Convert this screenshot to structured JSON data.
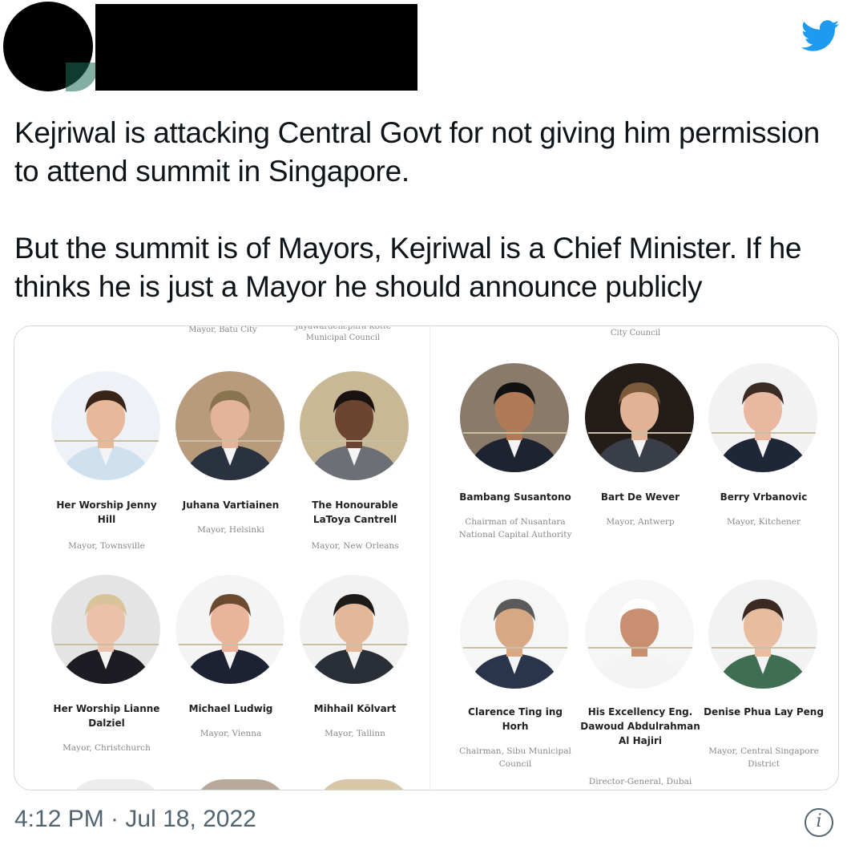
{
  "tweet": {
    "text_line1": "Kejriwal is attacking Central  Govt for not giving him permission to attend summit in Singapore.",
    "text_line2": "But the summit is of Mayors, Kejriwal is a Chief Minister. If he thinks he is just a Mayor he should announce publicly",
    "timestamp": "4:12 PM · Jul 18, 2022",
    "info_glyph": "i"
  },
  "media": {
    "top_captions": [
      "Mayor, Batu City",
      "Jayawardenepura Kotte Municipal Council",
      "City Council"
    ],
    "people": [
      {
        "name": "Her Worship Jenny Hill",
        "role": "Mayor, Townsville",
        "bg": "#eef2f6",
        "skin": "#e7b89a",
        "hair": "#3a2418",
        "suit": "#cfe0ef"
      },
      {
        "name": "Juhana Vartiainen",
        "role": "Mayor, Helsinki",
        "bg": "#b89a7c",
        "skin": "#e4b49a",
        "hair": "#8a7450",
        "suit": "#2a3240"
      },
      {
        "name": "The Honourable LaToya Cantrell",
        "role": "Mayor, New Orleans",
        "bg": "#c8b896",
        "skin": "#6b4532",
        "hair": "#1a1210",
        "suit": "#6d6f76"
      },
      {
        "name": "Bambang Susantono",
        "role": "Chairman of Nusantara National Capital Authority",
        "bg": "#8a7a6a",
        "skin": "#b07a56",
        "hair": "#111111",
        "suit": "#1e2330"
      },
      {
        "name": "Bart De Wever",
        "role": "Mayor, Antwerp",
        "bg": "#241c18",
        "skin": "#e2b294",
        "hair": "#7a5a3a",
        "suit": "#3a3e48"
      },
      {
        "name": "Berry Vrbanovic",
        "role": "Mayor, Kitchener",
        "bg": "#f2f2f2",
        "skin": "#e8b8a0",
        "hair": "#3a2c24",
        "suit": "#1f2638"
      },
      {
        "name": "Her Worship Lianne Dalziel",
        "role": "Mayor, Christchurch",
        "bg": "#e4e4e4",
        "skin": "#eac2aa",
        "hair": "#d8c498",
        "suit": "#1c1c22"
      },
      {
        "name": "Michael Ludwig",
        "role": "Mayor, Vienna",
        "bg": "#f4f4f4",
        "skin": "#e9b49a",
        "hair": "#6a4a30",
        "suit": "#1c2234"
      },
      {
        "name": "Mihhail Kõlvart",
        "role": "Mayor, Tallinn",
        "bg": "#f2f2f2",
        "skin": "#e2b898",
        "hair": "#1e1a18",
        "suit": "#2a2e36"
      },
      {
        "name": "Clarence Ting ing Horh",
        "role": "Chairman, Sibu Municipal Council",
        "bg": "#f6f6f6",
        "skin": "#d8a884",
        "hair": "#5a5a5a",
        "suit": "#2a344a"
      },
      {
        "name": "His Excellency Eng. Dawoud Abdulrahman Al Hajiri",
        "role": "Director-General, Dubai",
        "bg": "#f6f6f6",
        "skin": "#c89070",
        "hair": "#ffffff",
        "suit": "#f4f4f4"
      },
      {
        "name": "Denise Phua Lay Peng",
        "role": "Mayor, Central Singapore District",
        "bg": "#f2f2f2",
        "skin": "#e8bc9e",
        "hair": "#3a2a22",
        "suit": "#3f6e52"
      }
    ]
  },
  "colors": {
    "brand": "#1d9bf0",
    "text": "#0f1419",
    "secondary": "#536471",
    "border": "#cfd9de",
    "rule": "#c9bfa3"
  },
  "icons": {
    "logo": "twitter-bird-icon",
    "info": "info-circle-icon"
  }
}
